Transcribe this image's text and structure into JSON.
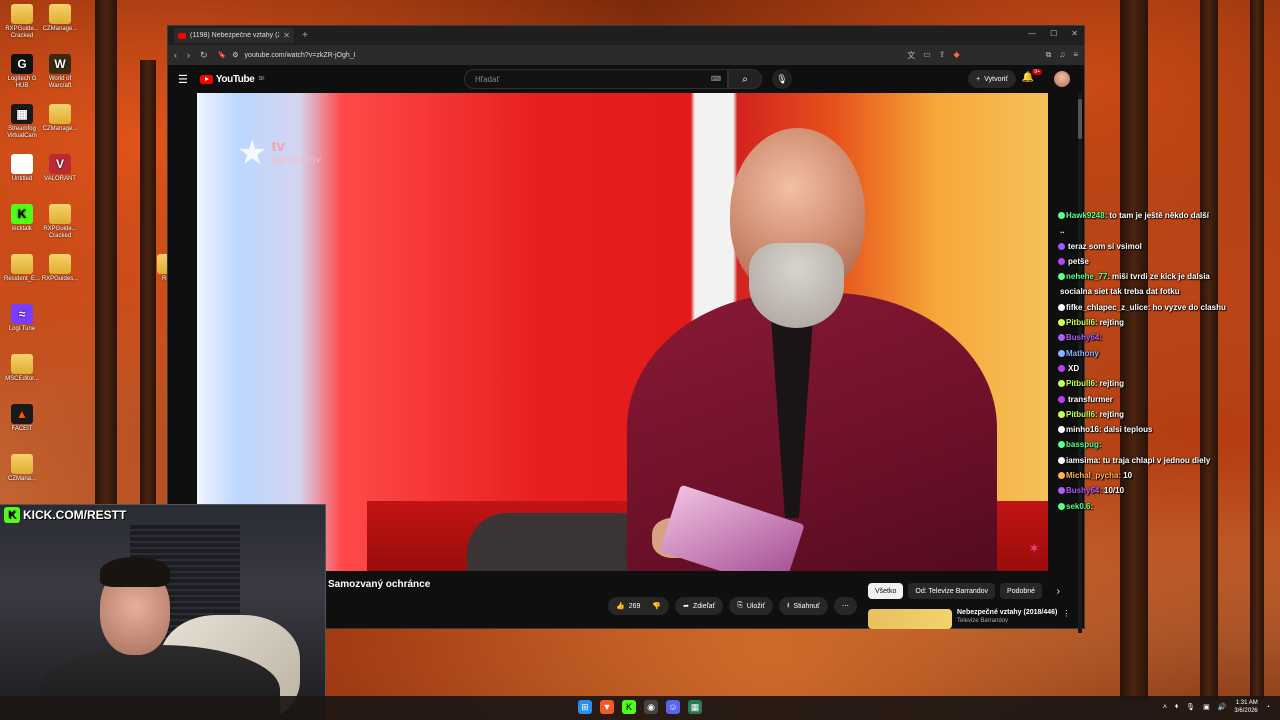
{
  "desktop": {
    "icons": [
      {
        "label": "RXPGuide... Cracked",
        "icon": "folder-icon"
      },
      {
        "label": "CZManage...",
        "icon": "folder-icon"
      },
      {
        "label": "Logitech G HUB",
        "icon": "logitech-icon"
      },
      {
        "label": "World of Warcraft",
        "icon": "wow-icon"
      },
      {
        "label": "Streamfog VirtualCam",
        "icon": "streamfog-icon"
      },
      {
        "label": "CZManage...",
        "icon": "folder-icon"
      },
      {
        "label": "Untitled",
        "icon": "document-icon"
      },
      {
        "label": "VALORANT",
        "icon": "valorant-icon"
      },
      {
        "label": "kicktalk",
        "icon": "kick-icon"
      },
      {
        "label": "RXPGuide... Cracked",
        "icon": "folder-icon"
      },
      {
        "label": "Resident_E...",
        "icon": "folder-icon"
      },
      {
        "label": "RXPGuides...",
        "icon": "folder-icon"
      },
      {
        "label": "Logi Tune",
        "icon": "logitune-icon"
      },
      {
        "label": "MSCEditor...",
        "icon": "folder-icon"
      },
      {
        "label": "FACEIT",
        "icon": "faceit-icon"
      },
      {
        "label": "CZMana...",
        "icon": "folder-icon"
      },
      {
        "label": "Resi",
        "icon": "folder-icon"
      }
    ]
  },
  "browser": {
    "tab_title": "(1198) Nebezpečné vztahy (2...",
    "url": "youtube.com/watch?v=zkZR-jOgh_I"
  },
  "youtube": {
    "logo": "YouTube",
    "region": "SK",
    "search_placeholder": "Hľadať",
    "create_label": "Vytvoriť",
    "notif_count": "9+",
    "video_title": "Samozvaný ochránce",
    "likes": "269",
    "share_label": "Zdieľať",
    "save_label": "Uložiť",
    "download_label": "Stiahnuť",
    "chips": [
      "Všetko",
      "Od: Televize Barrandov",
      "Podobné"
    ],
    "rec_title": "Nebezpečné vztahy (2018/446)",
    "rec_channel": "Televize Barrandov",
    "tv_logo_top": "tv",
    "tv_logo_bottom": "barrandov"
  },
  "chat": [
    {
      "user": "Hawk9248:",
      "color": "#5cff8a",
      "text": "to tam je ještě někdo další"
    },
    {
      "user": "",
      "color": "#ffffff",
      "text": ".."
    },
    {
      "user": "",
      "color": "#9b59ff",
      "text": "teraz som si vsimol"
    },
    {
      "user": "",
      "color": "#c03cff",
      "text": "petše"
    },
    {
      "user": "nehehe_77:",
      "color": "#5cff8a",
      "text": "miši tvrdi ze kick je dalsia"
    },
    {
      "user": "",
      "color": "#ffffff",
      "text": "socialna siet tak treba dat fotku"
    },
    {
      "user": "fifke_chlapec_z_ulice:",
      "color": "#ffffff",
      "text": "ho vyzve do clashu"
    },
    {
      "user": "Pitbull6:",
      "color": "#c6ff5c",
      "text": "rejting"
    },
    {
      "user": "Bushy64:",
      "color": "#b15cff",
      "text": ""
    },
    {
      "user": "Mathony",
      "color": "#8ab4ff",
      "text": ""
    },
    {
      "user": "",
      "color": "#c03cff",
      "text": "XD"
    },
    {
      "user": "Pitbull6:",
      "color": "#c6ff5c",
      "text": "rejting"
    },
    {
      "user": "",
      "color": "#c03cff",
      "text": "transfurmer"
    },
    {
      "user": "Pitbull6:",
      "color": "#c6ff5c",
      "text": "rejting"
    },
    {
      "user": "minho16:",
      "color": "#ffffff",
      "text": "dalsi teplous"
    },
    {
      "user": "basspug:",
      "color": "#5cff8a",
      "text": ""
    },
    {
      "user": "iamsima:",
      "color": "#ffffff",
      "text": "tu traja chlapi v jednou diely"
    },
    {
      "user": "Michal_pycha:",
      "color": "#ffb25c",
      "text": "10"
    },
    {
      "user": "Bushy64:",
      "color": "#b15cff",
      "text": "10/10"
    },
    {
      "user": "sek0.6:",
      "color": "#5cff8a",
      "text": ""
    }
  ],
  "webcam": {
    "banner": "KICK.COM/RESTT"
  },
  "taskbar": {
    "time": "1:31 AM",
    "date": "3/6/2026"
  }
}
